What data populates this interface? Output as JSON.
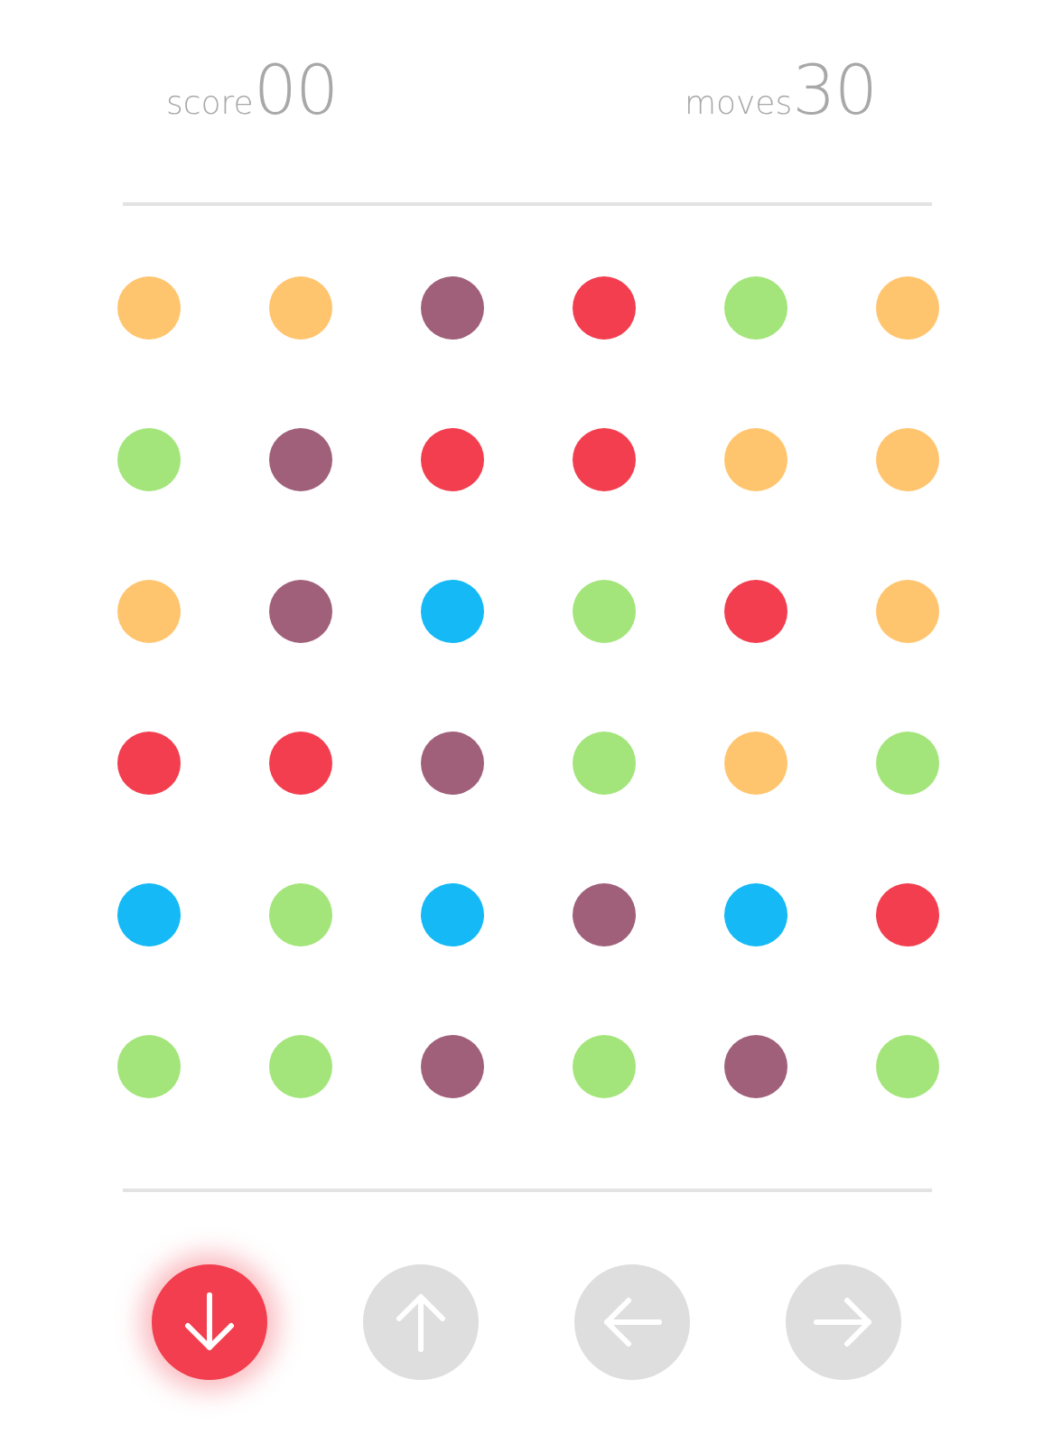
{
  "stats": [
    {
      "label": "score",
      "value": "00"
    },
    {
      "label": "moves",
      "value": "30"
    }
  ],
  "board": {
    "rows": [
      {
        "dots": [
          {
            "color": "#ffc56e"
          },
          {
            "color": "#ffc56e"
          },
          {
            "color": "#a0607a"
          },
          {
            "color": "#f23e4e"
          },
          {
            "color": "#a3e57a"
          },
          {
            "color": "#ffc56e"
          }
        ]
      },
      {
        "dots": [
          {
            "color": "#a3e57a"
          },
          {
            "color": "#a0607a"
          },
          {
            "color": "#f23e4e"
          },
          {
            "color": "#f23e4e"
          },
          {
            "color": "#ffc56e"
          },
          {
            "color": "#ffc56e"
          }
        ]
      },
      {
        "dots": [
          {
            "color": "#ffc56e"
          },
          {
            "color": "#a0607a"
          },
          {
            "color": "#14b9f5"
          },
          {
            "color": "#a3e57a"
          },
          {
            "color": "#f23e4e"
          },
          {
            "color": "#ffc56e"
          }
        ]
      },
      {
        "dots": [
          {
            "color": "#f23e4e"
          },
          {
            "color": "#f23e4e"
          },
          {
            "color": "#a0607a"
          },
          {
            "color": "#a3e57a"
          },
          {
            "color": "#ffc56e"
          },
          {
            "color": "#a3e57a"
          }
        ]
      },
      {
        "dots": [
          {
            "color": "#14b9f5"
          },
          {
            "color": "#a3e57a"
          },
          {
            "color": "#14b9f5"
          },
          {
            "color": "#a0607a"
          },
          {
            "color": "#14b9f5"
          },
          {
            "color": "#f23e4e"
          }
        ]
      },
      {
        "dots": [
          {
            "color": "#a3e57a"
          },
          {
            "color": "#a3e57a"
          },
          {
            "color": "#a0607a"
          },
          {
            "color": "#a3e57a"
          },
          {
            "color": "#a0607a"
          },
          {
            "color": "#a3e57a"
          }
        ]
      }
    ]
  },
  "controls": [
    {
      "kind": "down",
      "selected": true
    },
    {
      "kind": "up",
      "selected": false
    },
    {
      "kind": "left",
      "selected": false
    },
    {
      "kind": "right",
      "selected": false
    }
  ]
}
